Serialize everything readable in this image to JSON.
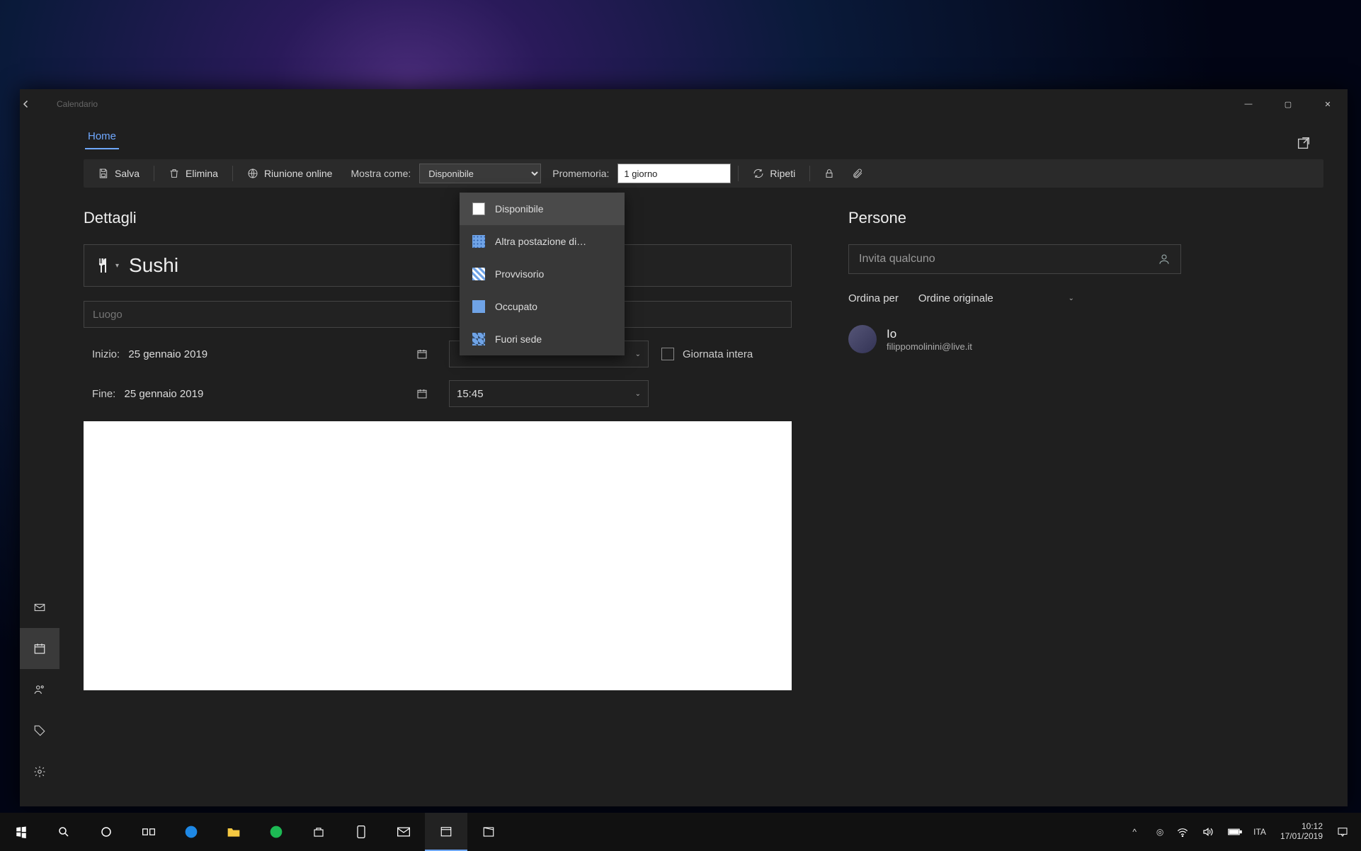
{
  "window": {
    "app_title": "Calendario",
    "tabs": {
      "home": "Home"
    },
    "winbtn": {
      "min": "—",
      "max": "▢",
      "close": "✕"
    }
  },
  "toolbar": {
    "save": "Salva",
    "delete": "Elimina",
    "online_meeting": "Riunione online",
    "show_as_label": "Mostra come:",
    "show_as_value": "Disponibile",
    "reminder_label": "Promemoria:",
    "reminder_value": "1 giorno",
    "repeat": "Ripeti"
  },
  "show_as_options": [
    {
      "key": "free",
      "label": "Disponibile",
      "swatch": "sw-free",
      "selected": true
    },
    {
      "key": "elsewhere",
      "label": "Altra postazione di…",
      "swatch": "sw-else"
    },
    {
      "key": "tentative",
      "label": "Provvisorio",
      "swatch": "sw-tent"
    },
    {
      "key": "busy",
      "label": "Occupato",
      "swatch": "sw-busy"
    },
    {
      "key": "oof",
      "label": "Fuori sede",
      "swatch": "sw-oof"
    }
  ],
  "details": {
    "heading": "Dettagli",
    "title_value": "Sushi",
    "location_placeholder": "Luogo",
    "start_label": "Inizio:",
    "start_date": "25 gennaio 2019",
    "end_label": "Fine:",
    "end_date": "25 gennaio 2019",
    "end_time": "15:45",
    "allday_label": "Giornata intera"
  },
  "people": {
    "heading": "Persone",
    "invite_placeholder": "Invita qualcuno",
    "sort_label": "Ordina per",
    "sort_value": "Ordine originale",
    "me_label": "Io",
    "me_email": "filippomolinini@live.it"
  },
  "taskbar": {
    "lang": "ITA",
    "time": "10:12",
    "date": "17/01/2019"
  }
}
